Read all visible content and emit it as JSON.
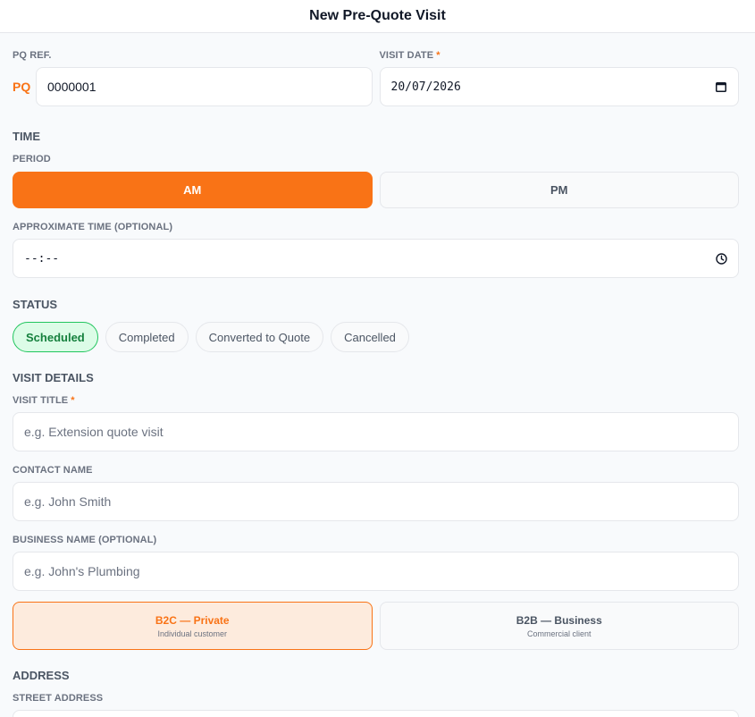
{
  "header": {
    "title": "New Pre-Quote Visit"
  },
  "pq_ref": {
    "label": "PQ REF.",
    "prefix": "PQ",
    "value": "0000001"
  },
  "visit_date": {
    "label": "VISIT DATE",
    "required_mark": "*",
    "value": "20/07/2026"
  },
  "time": {
    "section": "TIME",
    "period_label": "PERIOD",
    "periods": [
      {
        "label": "AM",
        "active": true
      },
      {
        "label": "PM",
        "active": false
      }
    ],
    "approx_label": "APPROXIMATE TIME (OPTIONAL)",
    "approx_value": "--:--"
  },
  "status": {
    "section": "STATUS",
    "options": [
      {
        "label": "Scheduled",
        "active": true
      },
      {
        "label": "Completed",
        "active": false
      },
      {
        "label": "Converted to Quote",
        "active": false
      },
      {
        "label": "Cancelled",
        "active": false
      }
    ]
  },
  "visit_details": {
    "section": "VISIT DETAILS",
    "title_label": "VISIT TITLE",
    "title_required": "*",
    "title_placeholder": "e.g. Extension quote visit",
    "contact_label": "CONTACT NAME",
    "contact_placeholder": "e.g. John Smith",
    "business_label": "BUSINESS NAME (OPTIONAL)",
    "business_placeholder": "e.g. John's Plumbing"
  },
  "customer_types": [
    {
      "title": "B2C — Private",
      "subtitle": "Individual customer",
      "active": true
    },
    {
      "title": "B2B — Business",
      "subtitle": "Commercial client",
      "active": false
    }
  ],
  "address": {
    "section": "ADDRESS",
    "street_label": "STREET ADDRESS"
  },
  "colors": {
    "accent": "#f97316",
    "success": "#22c55e",
    "success_bg": "#dcfce7",
    "b2c_bg": "#fdebdd"
  },
  "icons": {
    "calendar": "calendar-icon",
    "clock": "clock-icon"
  }
}
